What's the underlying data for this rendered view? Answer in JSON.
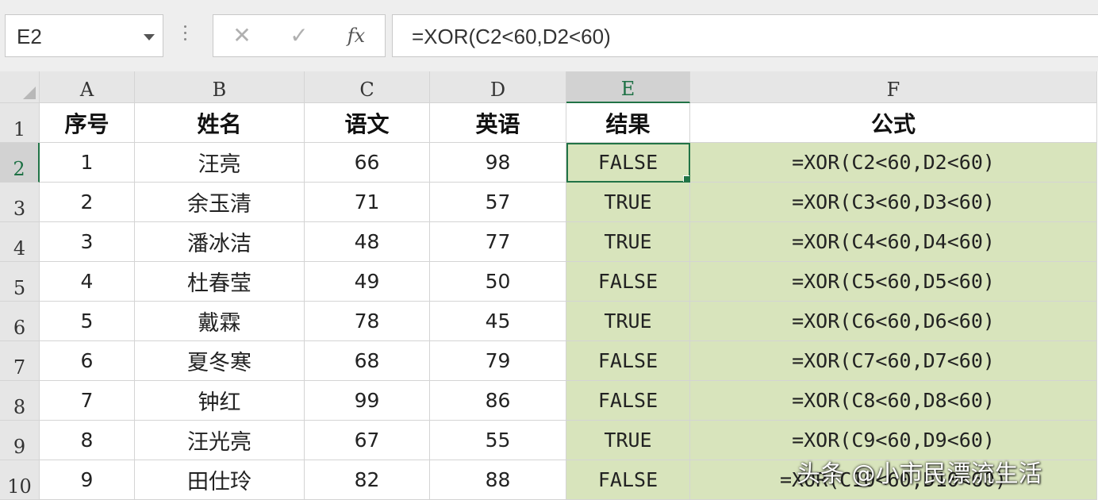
{
  "name_box": {
    "value": "E2"
  },
  "formula_bar": {
    "cancel_icon": "✕",
    "enter_icon": "✓",
    "fx_label": "fx",
    "value": "=XOR(C2<60,D2<60)"
  },
  "columns": [
    "A",
    "B",
    "C",
    "D",
    "E",
    "F"
  ],
  "selected_column": "E",
  "row_numbers": [
    "1",
    "2",
    "3",
    "4",
    "5",
    "6",
    "7",
    "8",
    "9",
    "10"
  ],
  "selected_row": "2",
  "headers": {
    "a": "序号",
    "b": "姓名",
    "c": "语文",
    "d": "英语",
    "e": "结果",
    "f": "公式"
  },
  "rows": [
    {
      "a": "1",
      "b": "汪亮",
      "c": "66",
      "d": "98",
      "e": "FALSE",
      "f": "=XOR(C2<60,D2<60)"
    },
    {
      "a": "2",
      "b": "余玉清",
      "c": "71",
      "d": "57",
      "e": "TRUE",
      "f": "=XOR(C3<60,D3<60)"
    },
    {
      "a": "3",
      "b": "潘冰洁",
      "c": "48",
      "d": "77",
      "e": "TRUE",
      "f": "=XOR(C4<60,D4<60)"
    },
    {
      "a": "4",
      "b": "杜春莹",
      "c": "49",
      "d": "50",
      "e": "FALSE",
      "f": "=XOR(C5<60,D5<60)"
    },
    {
      "a": "5",
      "b": "戴霖",
      "c": "78",
      "d": "45",
      "e": "TRUE",
      "f": "=XOR(C6<60,D6<60)"
    },
    {
      "a": "6",
      "b": "夏冬寒",
      "c": "68",
      "d": "79",
      "e": "FALSE",
      "f": "=XOR(C7<60,D7<60)"
    },
    {
      "a": "7",
      "b": "钟红",
      "c": "99",
      "d": "86",
      "e": "FALSE",
      "f": "=XOR(C8<60,D8<60)"
    },
    {
      "a": "8",
      "b": "汪光亮",
      "c": "67",
      "d": "55",
      "e": "TRUE",
      "f": "=XOR(C9<60,D9<60)"
    },
    {
      "a": "9",
      "b": "田仕玲",
      "c": "82",
      "d": "88",
      "e": "FALSE",
      "f": "=XOR(C10<60,D10<60)"
    }
  ],
  "colors": {
    "highlight_fill": "#d8e4bc",
    "selection": "#217346"
  },
  "watermark": "头条 @小市民漂流生活"
}
